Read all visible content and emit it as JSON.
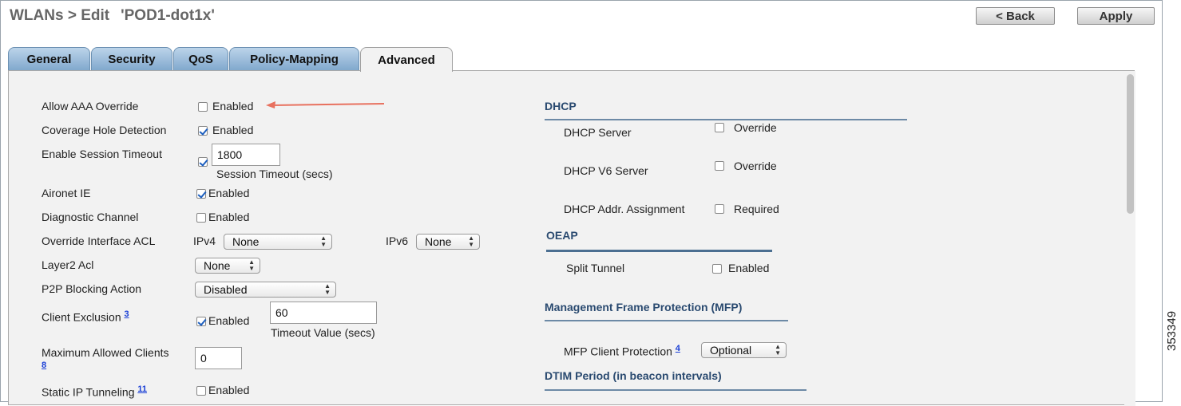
{
  "header": {
    "breadcrumb": "WLANs > Edit",
    "wlan_name": "'POD1-dot1x'",
    "back_label": "< Back",
    "apply_label": "Apply"
  },
  "tabs": [
    {
      "label": "General",
      "active": false
    },
    {
      "label": "Security",
      "active": false
    },
    {
      "label": "QoS",
      "active": false
    },
    {
      "label": "Policy-Mapping",
      "active": false
    },
    {
      "label": "Advanced",
      "active": true
    }
  ],
  "left": {
    "allow_aaa_override": {
      "label": "Allow AAA Override",
      "checkbox_label": "Enabled",
      "checked": false
    },
    "coverage_hole": {
      "label": "Coverage Hole Detection",
      "checkbox_label": "Enabled",
      "checked": true
    },
    "session_timeout": {
      "label": "Enable Session Timeout",
      "checked": true,
      "value": "1800",
      "unit_label": "Session Timeout (secs)"
    },
    "aironet_ie": {
      "label": "Aironet IE",
      "checkbox_label": "Enabled",
      "checked": true
    },
    "diagnostic_channel": {
      "label": "Diagnostic Channel",
      "checkbox_label": "Enabled",
      "checked": false
    },
    "override_acl": {
      "label": "Override Interface ACL",
      "ipv4_label": "IPv4",
      "ipv4_value": "None",
      "ipv6_label": "IPv6",
      "ipv6_value": "None"
    },
    "layer2_acl": {
      "label": "Layer2 Acl",
      "value": "None"
    },
    "p2p_blocking": {
      "label": "P2P Blocking Action",
      "value": "Disabled"
    },
    "client_exclusion": {
      "label": "Client Exclusion",
      "footnote": "3",
      "checkbox_label": "Enabled",
      "checked": true,
      "value": "60",
      "unit_label": "Timeout Value (secs)"
    },
    "max_clients": {
      "label": "Maximum Allowed Clients",
      "footnote": "8",
      "value": "0"
    },
    "static_ip": {
      "label": "Static IP Tunneling",
      "footnote": "11",
      "checkbox_label": "Enabled",
      "checked": false
    }
  },
  "right": {
    "dhcp": {
      "title": "DHCP",
      "server": {
        "label": "DHCP Server",
        "checkbox_label": "Override",
        "checked": false
      },
      "v6_server": {
        "label": "DHCP V6 Server",
        "checkbox_label": "Override",
        "checked": false
      },
      "addr_assignment": {
        "label": "DHCP Addr. Assignment",
        "checkbox_label": "Required",
        "checked": false
      }
    },
    "oeap": {
      "title": "OEAP",
      "split_tunnel": {
        "label": "Split Tunnel",
        "checkbox_label": "Enabled",
        "checked": false
      }
    },
    "mfp": {
      "title": "Management Frame Protection (MFP)",
      "client_protection": {
        "label": "MFP Client Protection",
        "footnote": "4",
        "value": "Optional"
      }
    },
    "dtim": {
      "title": "DTIM Period (in beacon intervals)"
    }
  },
  "annotation": {
    "color": "#e8715f"
  },
  "figure_id": "353349"
}
